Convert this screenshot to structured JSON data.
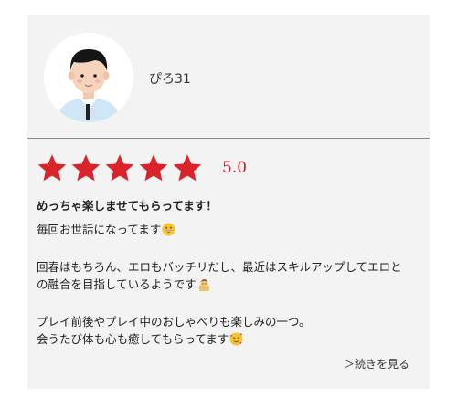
{
  "review": {
    "username": "ぴろ31",
    "rating": 5,
    "score_text": "5.0",
    "title": "めっちゃ楽しませてもらってます！",
    "paragraphs": [
      {
        "lines": [
          "毎回お世話になってます"
        ],
        "emoji": "grinning-face-emoji"
      },
      {
        "lines": [
          "回春はもちろん、エロもバッチリだし、最近はスキルアップしてエロと",
          "の融合を目指しているようです"
        ],
        "emoji": "spa-person-emoji"
      },
      {
        "lines": [
          "プレイ前後やプレイ中のおしゃべりも楽しみの一つ。",
          "会うたび体も心も癒してもらってます"
        ],
        "emoji": "smiling-face-with-hearts-emoji"
      }
    ],
    "read_more": "＞続きを見る"
  },
  "colors": {
    "star": "#d9222a",
    "score": "#c4202b",
    "card_bg": "#f3f3f3"
  }
}
